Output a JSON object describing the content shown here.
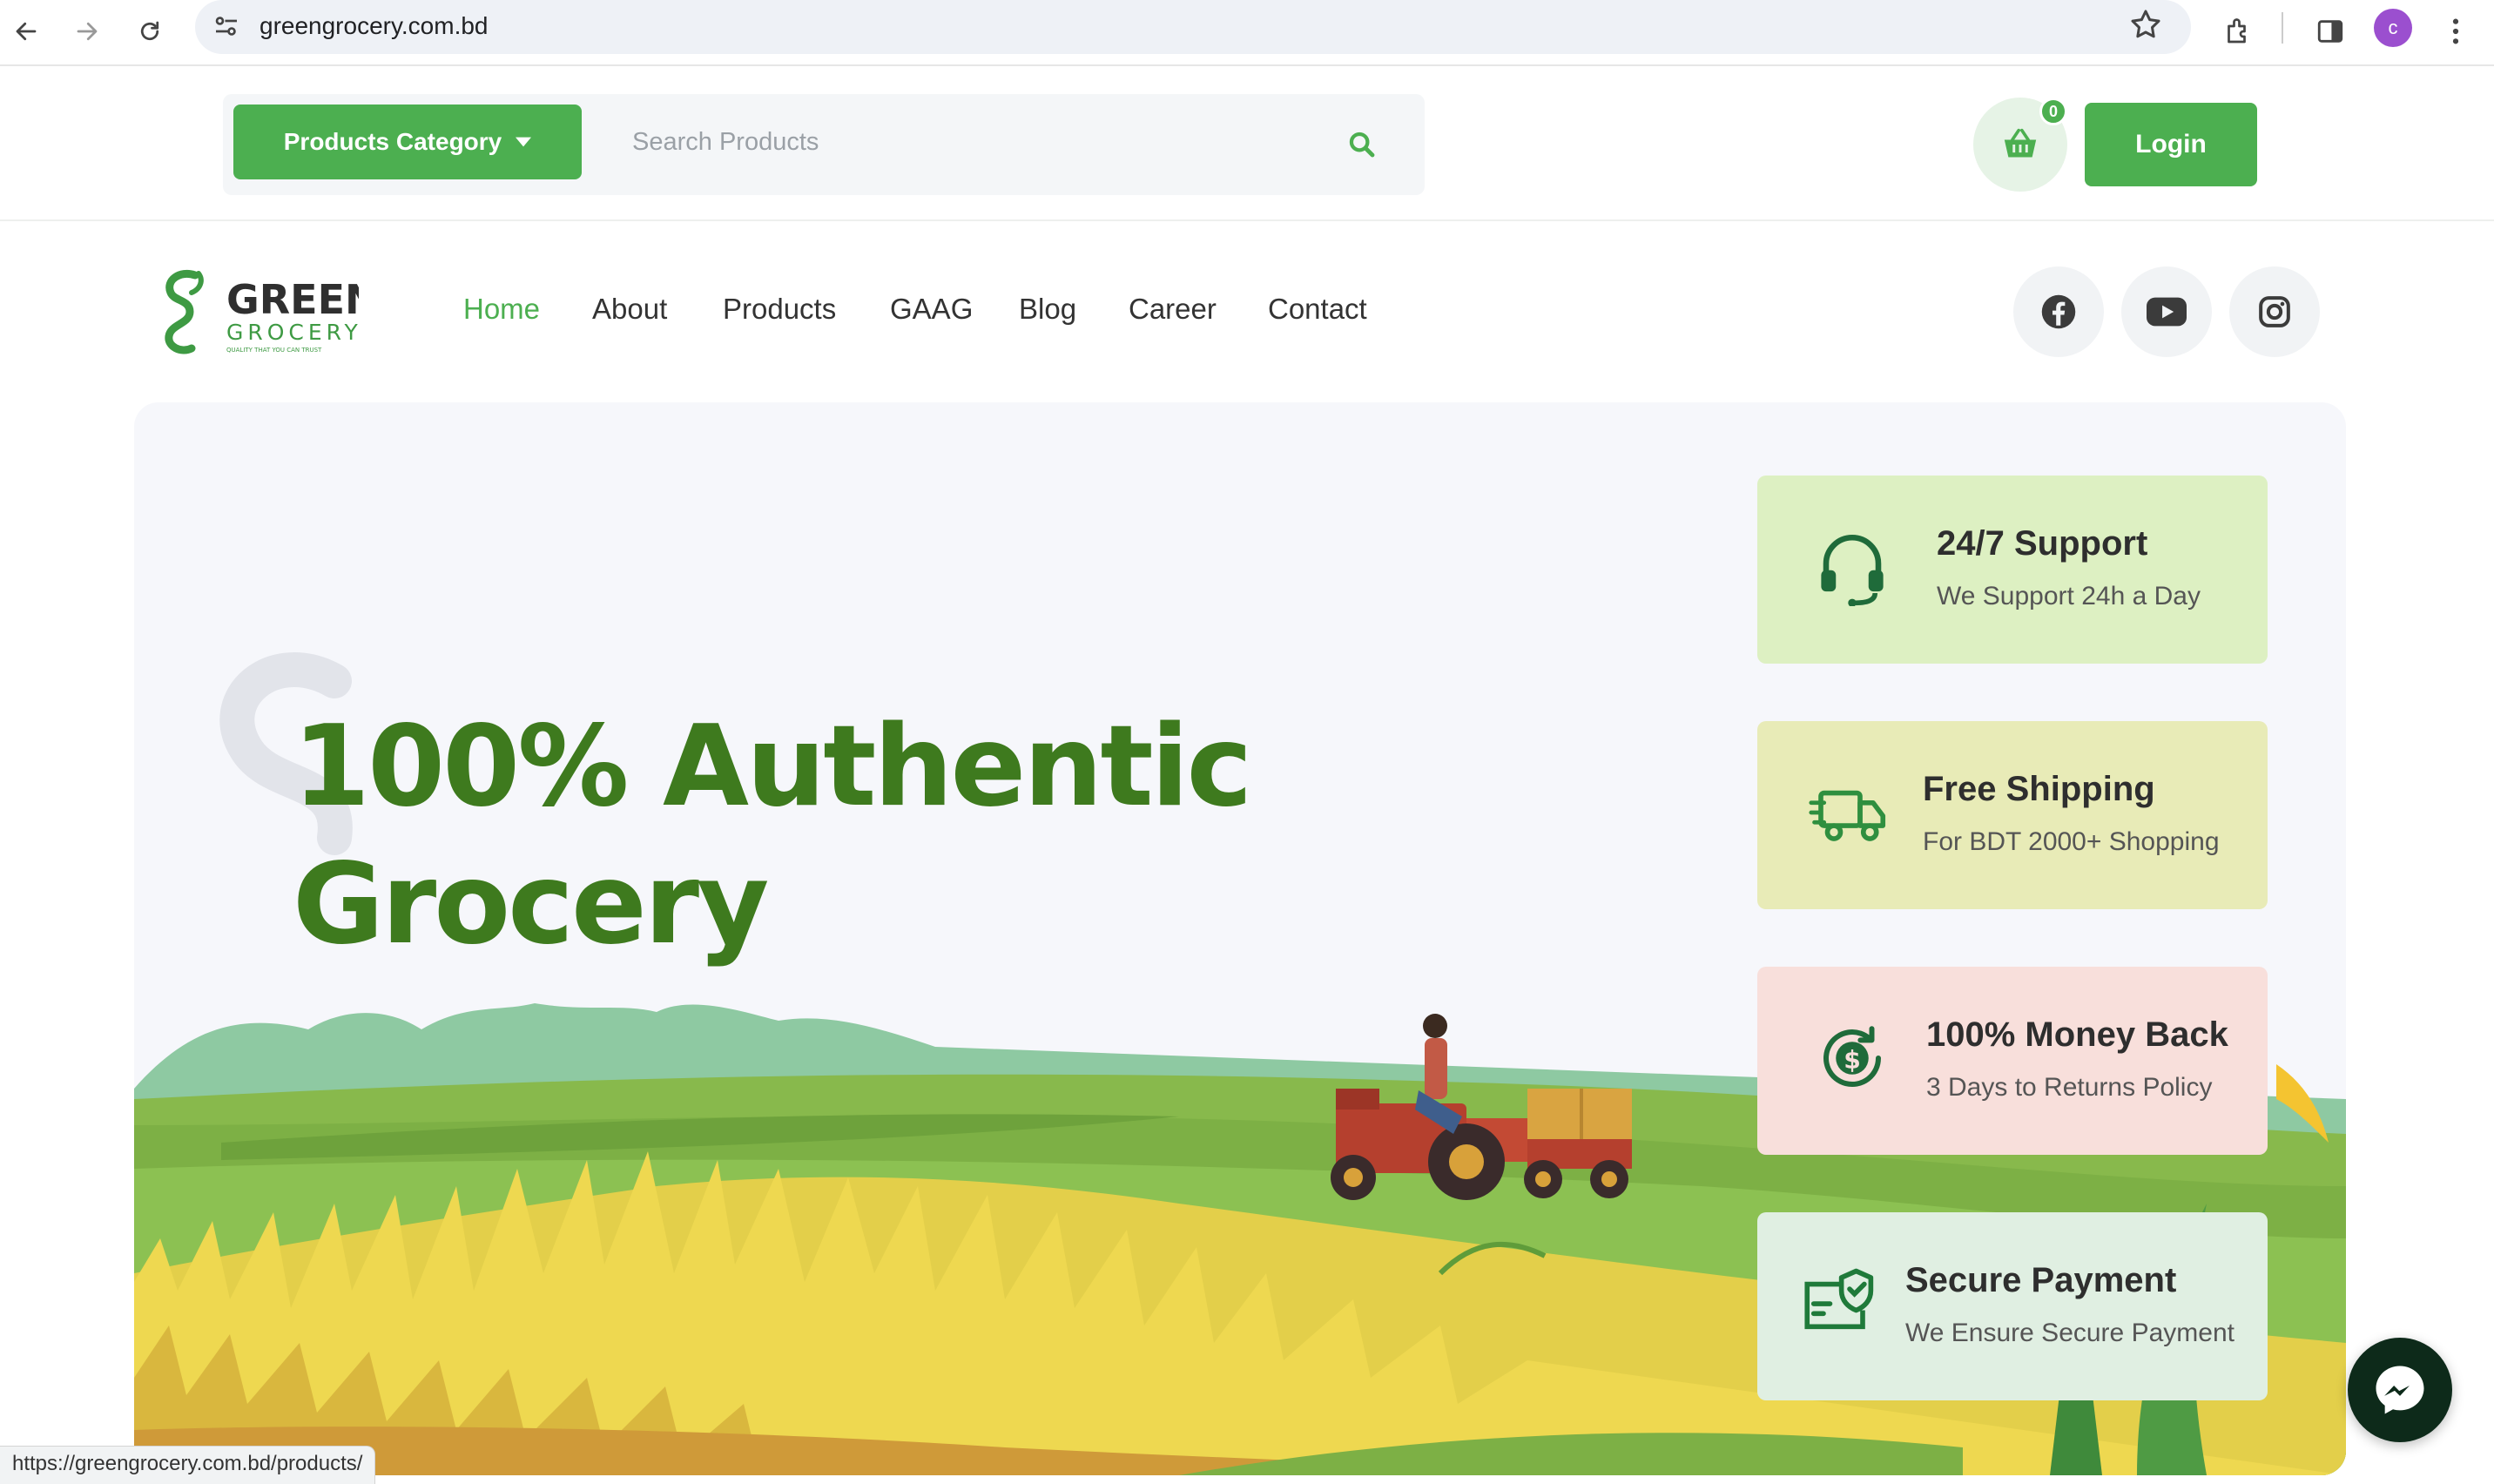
{
  "browser": {
    "url": "greengrocery.com.bd",
    "avatar_letter": "c",
    "status_url": "https://greengrocery.com.bd/products/"
  },
  "topbar": {
    "category_label": "Products Category",
    "search_placeholder": "Search Products",
    "cart_count": "0",
    "login_label": "Login"
  },
  "nav": {
    "logo_word": "GREEN",
    "logo_sub": "GROCERY",
    "logo_tagline": "QUALITY THAT YOU CAN TRUST",
    "items": [
      {
        "label": "Home",
        "active": true
      },
      {
        "label": "About"
      },
      {
        "label": "Products"
      },
      {
        "label": "GAAG"
      },
      {
        "label": "Blog"
      },
      {
        "label": "Career"
      },
      {
        "label": "Contact"
      }
    ],
    "social": [
      "facebook-icon",
      "youtube-icon",
      "instagram-icon"
    ]
  },
  "hero": {
    "title_line1": "100% Authentic",
    "title_line2": "Grocery"
  },
  "features": [
    {
      "title": "24/7 Support",
      "subtitle": "We Support 24h a Day",
      "icon": "headset-icon",
      "bg": "#ddf0c2"
    },
    {
      "title": "Free Shipping",
      "subtitle": "For BDT 2000+ Shopping",
      "icon": "truck-icon",
      "bg": "#e8ebb7"
    },
    {
      "title": "100% Money Back",
      "subtitle": "3 Days to Returns Policy",
      "icon": "money-back-icon",
      "bg": "#f8dfdb"
    },
    {
      "title": "Secure Payment",
      "subtitle": "We Ensure Secure Payment",
      "icon": "secure-payment-icon",
      "bg": "#e0efe2"
    }
  ],
  "colors": {
    "brand_green": "#4caf50",
    "hero_title": "#3e7a1e"
  }
}
